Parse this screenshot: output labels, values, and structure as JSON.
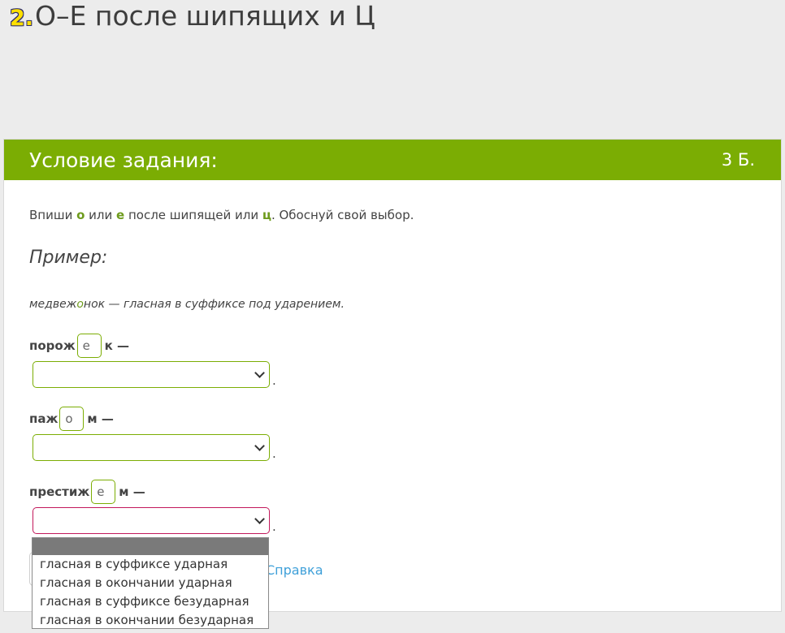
{
  "page": {
    "number": "2.",
    "title": "О–Е после шипящих и Ц"
  },
  "card": {
    "header_title": "Условие задания:",
    "points": "3 Б."
  },
  "instruction": {
    "p1": "Впиши ",
    "o": "о",
    "p2": " или ",
    "e": "е",
    "p3": " после шипящей или ",
    "c": "ц",
    "p4": ". Обоснуй свой выбор."
  },
  "example": {
    "heading": "Пример:",
    "word_start": "медвеж",
    "word_letter": "о",
    "word_end": "нок — гласная в суффиксе под ударением."
  },
  "tasks": [
    {
      "prefix": "порож",
      "letter": "е",
      "suffix": "к —",
      "selected": ""
    },
    {
      "prefix": "паж",
      "letter": "о",
      "suffix": "м —",
      "selected": ""
    },
    {
      "prefix": "престиж",
      "letter": "е",
      "suffix": "м —",
      "selected": ""
    }
  ],
  "period": ".",
  "dropdown": {
    "options": [
      "гласная в суффиксе ударная",
      "гласная в окончании ударная",
      "гласная в суффиксе безударная",
      "гласная в окончании безударная"
    ]
  },
  "help_link": "Справка",
  "colors": {
    "accent_green": "#7bad03",
    "active_border": "#c2185b",
    "link_blue": "#3fa0d9"
  }
}
